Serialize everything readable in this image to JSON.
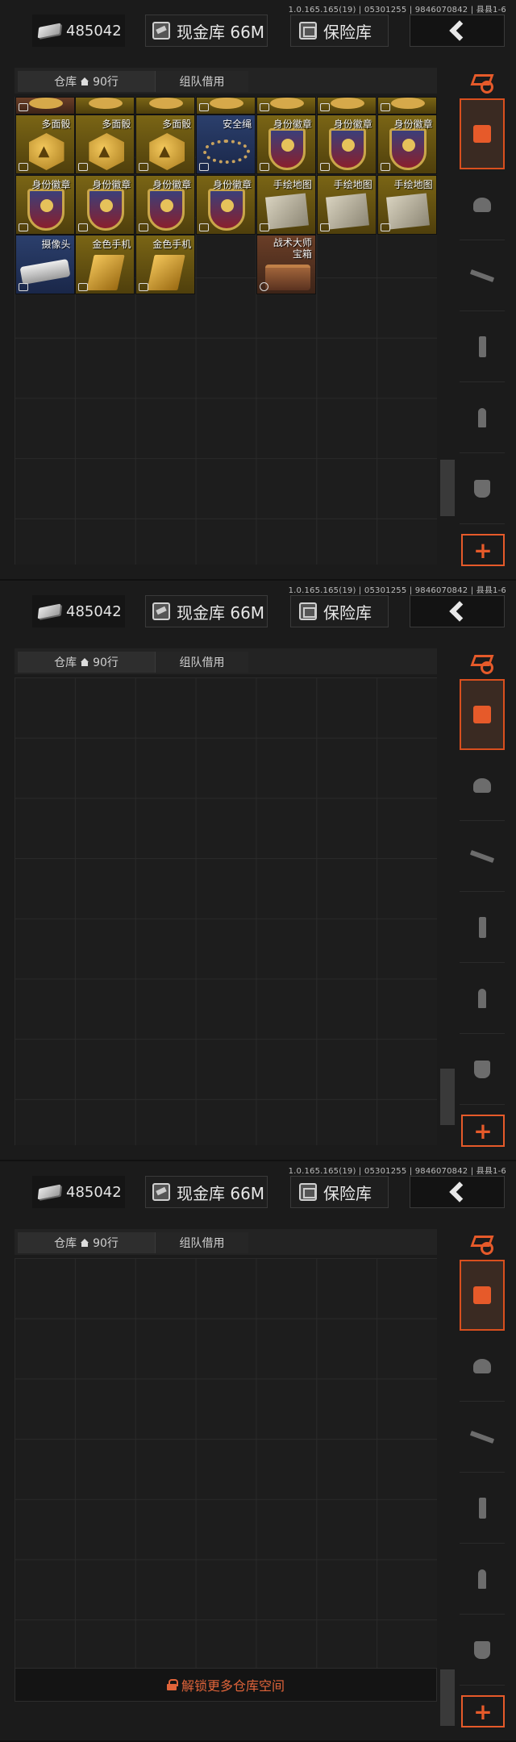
{
  "version_text": "1.0.165.165(19) | 05301255 | 9846070842 | 县县1-6",
  "header": {
    "cash_amount": "485042",
    "cash_vault_label": "现金库 66M",
    "safe_label": "保险库"
  },
  "tabs": {
    "warehouse_label": "仓库",
    "warehouse_rows": "90行",
    "team_label": "组队借用"
  },
  "items": [
    {
      "name": "",
      "icon": "exit-icon",
      "rarity": "brown"
    },
    {
      "name": "",
      "icon": "",
      "rarity": "gold"
    },
    {
      "name": "",
      "icon": "",
      "rarity": "gold"
    },
    {
      "name": "",
      "icon": "exit-icon",
      "rarity": "gold"
    },
    {
      "name": "",
      "icon": "exit-icon",
      "rarity": "gold"
    },
    {
      "name": "",
      "icon": "exit-icon",
      "rarity": "gold"
    },
    {
      "name": "",
      "icon": "exit-icon",
      "rarity": "gold"
    },
    {
      "name": "多面骰",
      "icon": "box-icon",
      "rarity": "gold"
    },
    {
      "name": "多面骰",
      "icon": "exit-icon",
      "rarity": "gold"
    },
    {
      "name": "多面骰",
      "icon": "exit-icon",
      "rarity": "gold"
    },
    {
      "name": "安全绳",
      "icon": "exit-icon",
      "rarity": "blue"
    },
    {
      "name": "身份徽章",
      "icon": "exit-icon",
      "rarity": "gold"
    },
    {
      "name": "身份徽章",
      "icon": "exit-icon",
      "rarity": "gold"
    },
    {
      "name": "身份徽章",
      "icon": "exit-icon",
      "rarity": "gold"
    },
    {
      "name": "身份徽章",
      "icon": "exit-icon",
      "rarity": "gold"
    },
    {
      "name": "身份徽章",
      "icon": "exit-icon",
      "rarity": "gold"
    },
    {
      "name": "身份徽章",
      "icon": "exit-icon",
      "rarity": "gold"
    },
    {
      "name": "身份徽章",
      "icon": "exit-icon",
      "rarity": "gold"
    },
    {
      "name": "手绘地图",
      "icon": "box-icon",
      "rarity": "gold"
    },
    {
      "name": "手绘地图",
      "icon": "box-icon",
      "rarity": "gold"
    },
    {
      "name": "手绘地图",
      "icon": "box-icon",
      "rarity": "gold"
    },
    {
      "name": "摄像头",
      "icon": "box-icon",
      "rarity": "blue"
    },
    {
      "name": "金色手机",
      "icon": "exit-icon",
      "rarity": "gold"
    },
    {
      "name": "金色手机",
      "icon": "exit-icon",
      "rarity": "gold"
    },
    {
      "name": "战术大师宝箱",
      "icon": "clock-icon",
      "rarity": "brown"
    }
  ],
  "unlock_label": "解锁更多仓库空间",
  "plus_label": "+",
  "colors": {
    "accent": "#e65a2a",
    "gold_item": "#6a5612",
    "blue_item": "#24365f"
  }
}
